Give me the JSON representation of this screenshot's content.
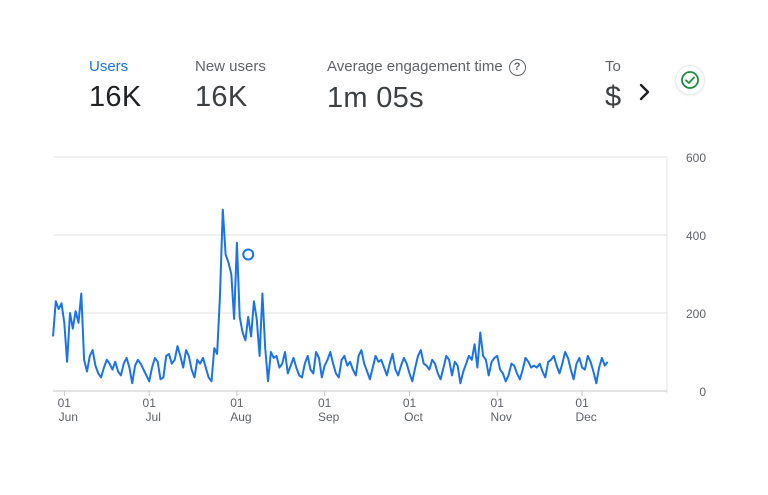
{
  "metrics": [
    {
      "label": "Users",
      "value": "16K"
    },
    {
      "label": "New users",
      "value": "16K"
    },
    {
      "label": "Average engagement time",
      "value": "1m 05s"
    },
    {
      "label": "To",
      "value": "$"
    }
  ],
  "icons": {
    "help": "help-icon",
    "next": "chevron-right-icon",
    "status": "check-circle-icon"
  },
  "colors": {
    "accent": "#1a73e8",
    "line": "#1a73e8",
    "status": "#1e8e3e"
  },
  "chart_data": {
    "type": "line",
    "title": "",
    "xlabel": "",
    "ylabel": "",
    "ylim": [
      0,
      600
    ],
    "yticks": [
      0,
      200,
      400,
      600
    ],
    "x_start": "2023-05-28",
    "x_end": "2023-12-31",
    "xticks": [
      {
        "date": "2023-06-01",
        "day": "01",
        "month": "Jun"
      },
      {
        "date": "2023-07-01",
        "day": "01",
        "month": "Jul"
      },
      {
        "date": "2023-08-01",
        "day": "01",
        "month": "Aug"
      },
      {
        "date": "2023-09-01",
        "day": "01",
        "month": "Sep"
      },
      {
        "date": "2023-10-01",
        "day": "01",
        "month": "Oct"
      },
      {
        "date": "2023-11-01",
        "day": "01",
        "month": "Nov"
      },
      {
        "date": "2023-12-01",
        "day": "01",
        "month": "Dec"
      }
    ],
    "grid": true,
    "series": [
      {
        "name": "Users",
        "values": [
          140,
          230,
          210,
          225,
          175,
          75,
          200,
          160,
          205,
          175,
          250,
          80,
          50,
          90,
          105,
          65,
          45,
          35,
          60,
          80,
          70,
          55,
          75,
          50,
          40,
          70,
          85,
          60,
          20,
          65,
          80,
          70,
          55,
          40,
          25,
          60,
          85,
          75,
          30,
          35,
          90,
          95,
          70,
          80,
          115,
          90,
          60,
          105,
          90,
          55,
          35,
          80,
          70,
          85,
          60,
          35,
          25,
          110,
          95,
          240,
          465,
          350,
          330,
          300,
          185,
          380,
          190,
          150,
          130,
          190,
          140,
          230,
          185,
          90,
          250,
          110,
          25,
          100,
          85,
          90,
          60,
          70,
          100,
          45,
          65,
          85,
          60,
          40,
          35,
          70,
          90,
          55,
          45,
          100,
          85,
          35,
          65,
          80,
          100,
          70,
          45,
          35,
          80,
          90,
          65,
          75,
          55,
          40,
          90,
          105,
          70,
          50,
          30,
          60,
          90,
          75,
          80,
          60,
          40,
          70,
          95,
          55,
          40,
          65,
          85,
          70,
          45,
          25,
          60,
          90,
          105,
          70,
          65,
          55,
          80,
          70,
          45,
          30,
          60,
          90,
          80,
          40,
          75,
          65,
          20,
          50,
          70,
          90,
          80,
          120,
          60,
          150,
          90,
          80,
          40,
          75,
          85,
          90,
          55,
          45,
          25,
          40,
          70,
          65,
          45,
          30,
          55,
          85,
          75,
          60,
          65,
          60,
          70,
          50,
          35,
          75,
          80,
          90,
          65,
          45,
          70,
          100,
          85,
          55,
          30,
          70,
          85,
          60,
          55,
          90,
          75,
          50,
          20,
          60,
          85,
          65,
          75
        ]
      }
    ],
    "marker": {
      "date": "2023-08-05",
      "value": 350
    }
  }
}
